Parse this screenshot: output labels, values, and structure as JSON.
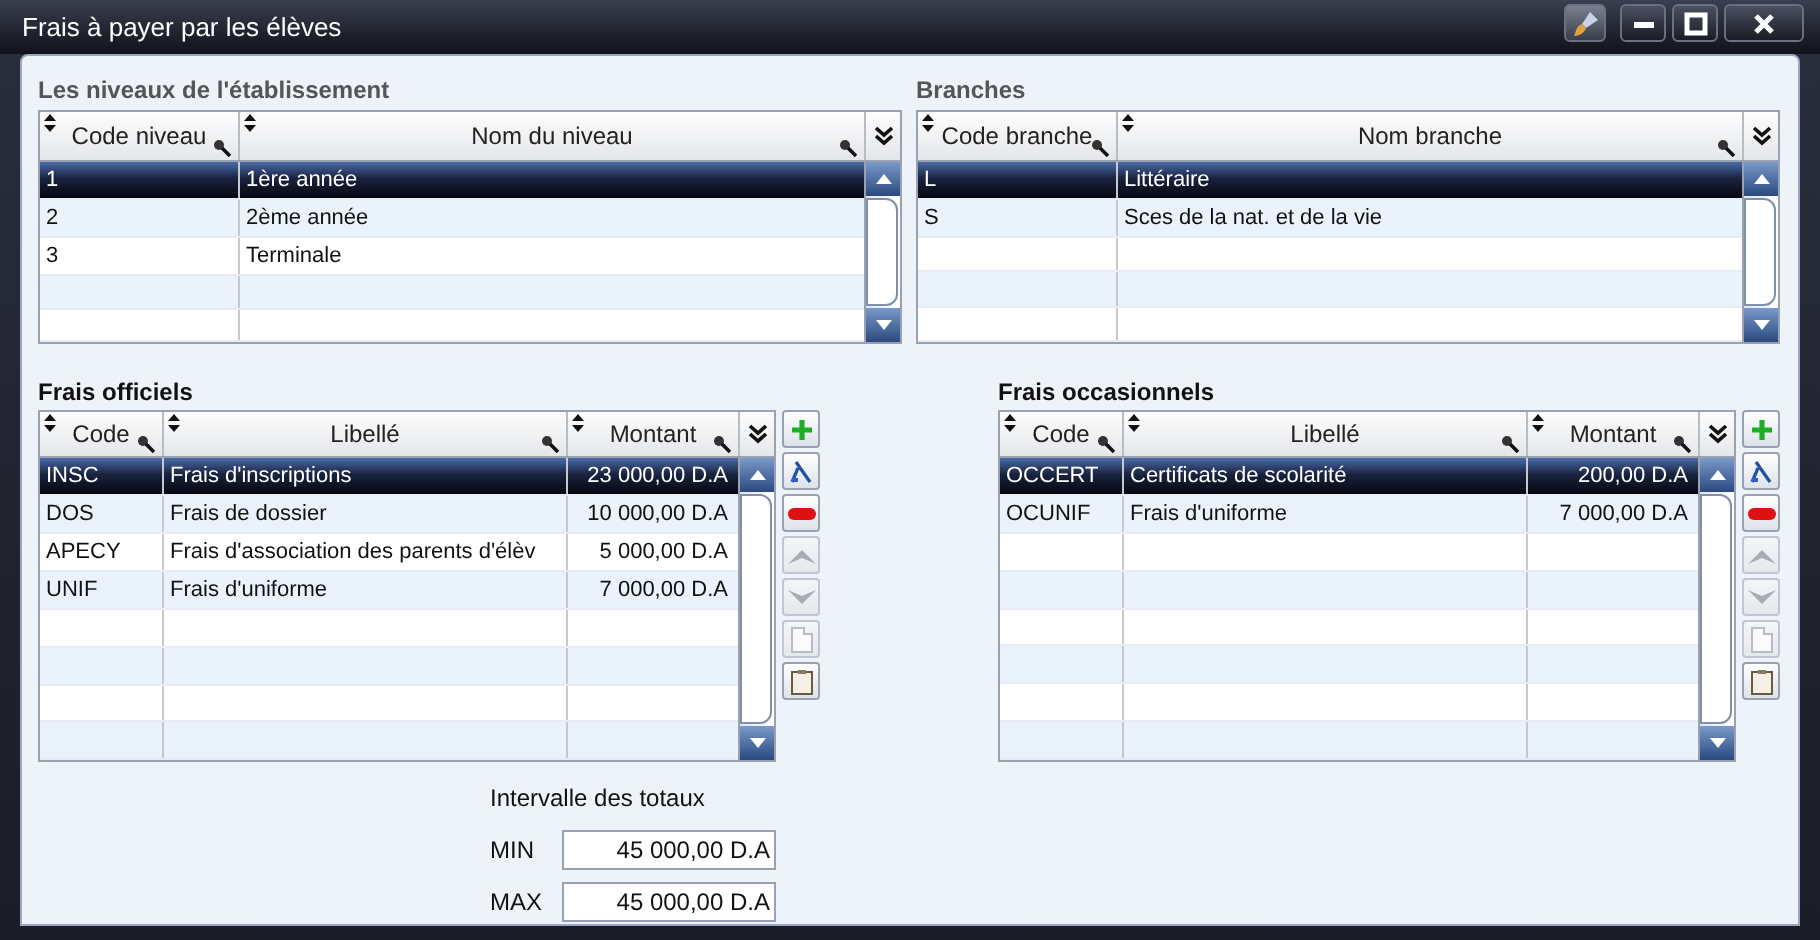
{
  "window": {
    "title": "Frais à payer par les élèves"
  },
  "levels": {
    "title": "Les niveaux de l'établissement",
    "columns": [
      {
        "label": "Code niveau",
        "kind": "text"
      },
      {
        "label": "Nom du niveau",
        "kind": "text"
      }
    ],
    "rows": [
      {
        "cells": [
          "1",
          "1ère année"
        ],
        "selected": true
      },
      {
        "cells": [
          "2",
          "2ème année"
        ],
        "selected": false
      },
      {
        "cells": [
          "3",
          "Terminale"
        ],
        "selected": false
      }
    ]
  },
  "branches": {
    "title": "Branches",
    "columns": [
      {
        "label": "Code branche",
        "kind": "text"
      },
      {
        "label": "Nom branche",
        "kind": "text"
      }
    ],
    "rows": [
      {
        "cells": [
          "L",
          "Littéraire"
        ],
        "selected": true
      },
      {
        "cells": [
          "S",
          "Sces de la nat. et de la vie"
        ],
        "selected": false
      }
    ]
  },
  "official_fees": {
    "title": "Frais officiels",
    "columns": [
      {
        "label": "Code",
        "kind": "text"
      },
      {
        "label": "Libellé",
        "kind": "text"
      },
      {
        "label": "Montant",
        "kind": "amount"
      }
    ],
    "rows": [
      {
        "cells": [
          "INSC",
          "Frais d'inscriptions",
          "23 000,00 D.A"
        ],
        "selected": true
      },
      {
        "cells": [
          "DOS",
          "Frais de dossier",
          "10 000,00 D.A"
        ],
        "selected": false
      },
      {
        "cells": [
          "APECY",
          "Frais d'association des parents d'élèv",
          "5 000,00 D.A"
        ],
        "selected": false
      },
      {
        "cells": [
          "UNIF",
          "Frais d'uniforme",
          "7 000,00 D.A"
        ],
        "selected": false
      }
    ],
    "actions": [
      {
        "kind": "add",
        "disabled": false
      },
      {
        "kind": "edit",
        "disabled": false
      },
      {
        "kind": "delete",
        "disabled": false
      },
      {
        "kind": "up",
        "disabled": true
      },
      {
        "kind": "down",
        "disabled": true
      },
      {
        "kind": "copy",
        "disabled": true
      },
      {
        "kind": "paste",
        "disabled": false
      }
    ]
  },
  "occasional_fees": {
    "title": "Frais occasionnels",
    "columns": [
      {
        "label": "Code",
        "kind": "text"
      },
      {
        "label": "Libellé",
        "kind": "text"
      },
      {
        "label": "Montant",
        "kind": "amount"
      }
    ],
    "rows": [
      {
        "cells": [
          "OCCERT",
          "Certificats de scolarité",
          "200,00 D.A"
        ],
        "selected": true
      },
      {
        "cells": [
          "OCUNIF",
          "Frais d'uniforme",
          "7 000,00 D.A"
        ],
        "selected": false
      }
    ],
    "actions": [
      {
        "kind": "add",
        "disabled": false
      },
      {
        "kind": "edit",
        "disabled": false
      },
      {
        "kind": "delete",
        "disabled": false
      },
      {
        "kind": "up",
        "disabled": true
      },
      {
        "kind": "down",
        "disabled": true
      },
      {
        "kind": "copy",
        "disabled": true
      },
      {
        "kind": "paste",
        "disabled": false
      }
    ]
  },
  "totals": {
    "title": "Intervalle des totaux",
    "fields": [
      {
        "label": "MIN",
        "value": "45 000,00 D.A"
      },
      {
        "label": "MAX",
        "value": "45 000,00 D.A"
      }
    ]
  }
}
